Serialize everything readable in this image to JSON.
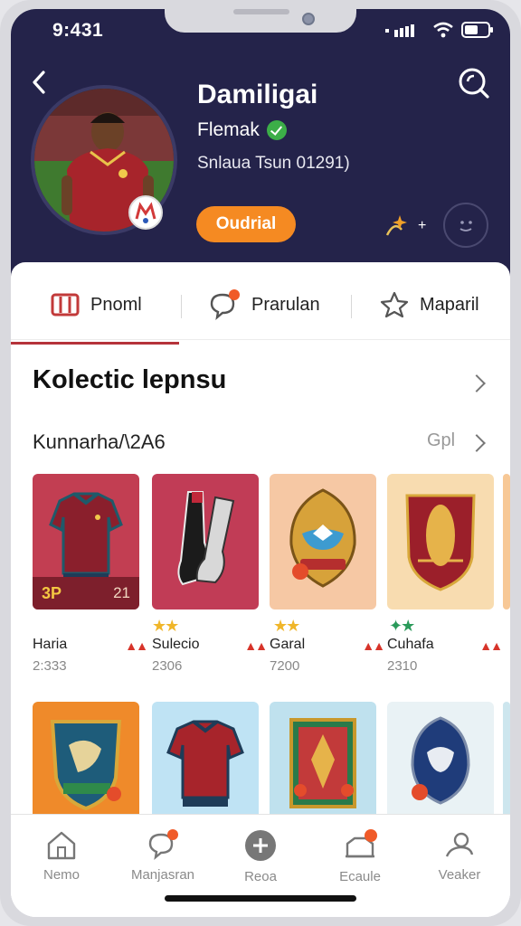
{
  "status_bar": {
    "time": "9:431"
  },
  "profile": {
    "name": "Damiligai",
    "subtitle": "Flemak",
    "meta": "Snlaua Tsun 01291)",
    "follow_label": "Oudrial"
  },
  "tabs": [
    {
      "label": "Pnoml",
      "icon": "brand-icon",
      "active": true
    },
    {
      "label": "Prarulan",
      "icon": "chat-icon",
      "active": false
    },
    {
      "label": "Maparil",
      "icon": "star-icon",
      "active": false
    }
  ],
  "collection": {
    "title": "Kolectic lepnsu",
    "subtitle": "Kunnarha/\\2A6",
    "link": "Gpl"
  },
  "cards_row1": [
    {
      "type": "jersey",
      "rating": "3P",
      "rating_sub": "21",
      "name": "Haria",
      "number": "2:333",
      "hot": "▲▲"
    },
    {
      "type": "boots",
      "stars": "★★",
      "name": "Sulecio",
      "number": "2306",
      "hot": "▲▲"
    },
    {
      "type": "crest-peach",
      "stars": "★★",
      "name": "Garal",
      "number": "7200",
      "hot": "▲▲"
    },
    {
      "type": "crest-gold",
      "stars": "✦★",
      "name": "Cuhafa",
      "number": "2310",
      "hot": "▲▲"
    }
  ],
  "bottom_nav": [
    {
      "label": "Nemo",
      "icon": "home-icon"
    },
    {
      "label": "Manjasran",
      "icon": "message-icon"
    },
    {
      "label": "Reoa",
      "icon": "plus-circle-icon"
    },
    {
      "label": "Ecaule",
      "icon": "inbox-icon"
    },
    {
      "label": "Veaker",
      "icon": "profile-icon"
    }
  ],
  "colors": {
    "header_bg": "#24234a",
    "accent": "#f58a22",
    "tab_active": "#b5333a",
    "badge": "#f05a28"
  }
}
